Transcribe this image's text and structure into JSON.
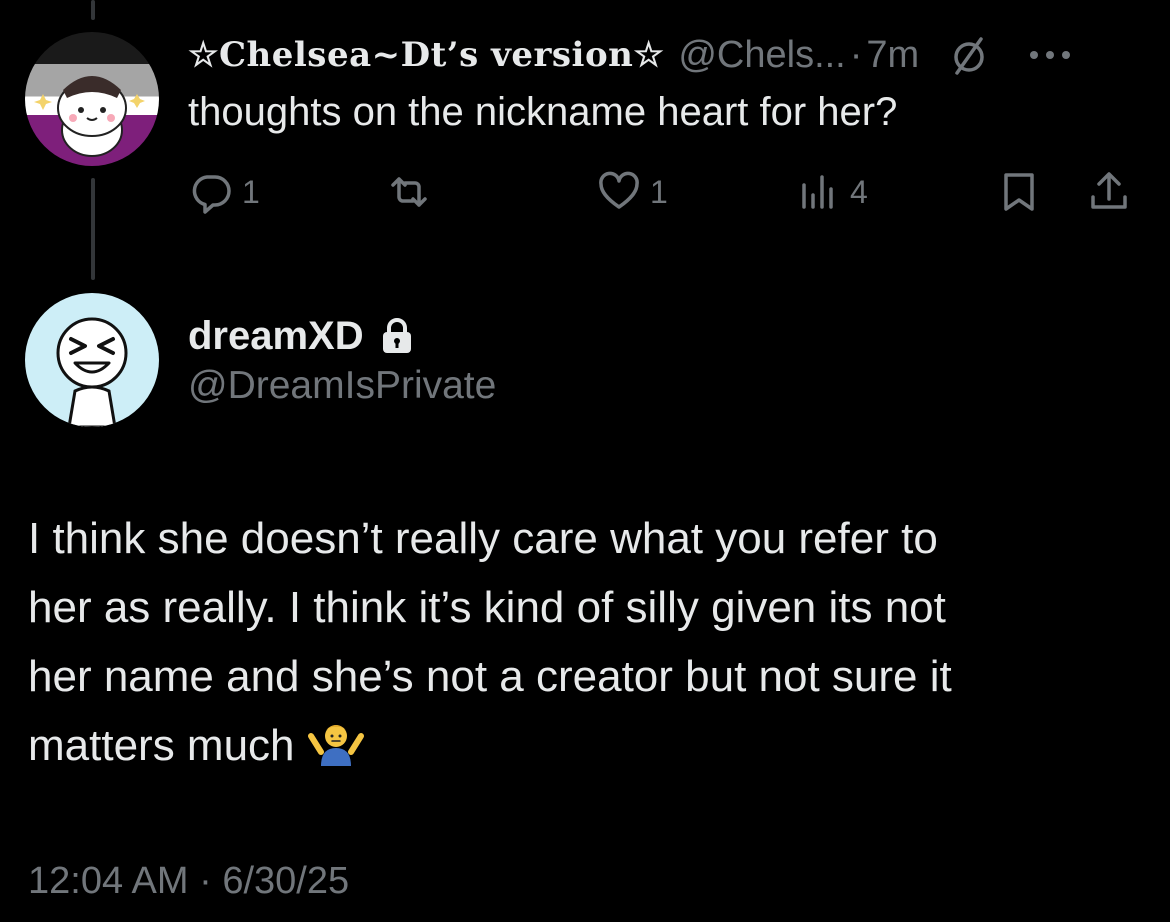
{
  "parent_tweet": {
    "display_name": "☆Chelsea~Dt’s version☆",
    "handle": "@Chels...",
    "separator": "·",
    "time": "7m",
    "text": "thoughts on the nickname heart for her?",
    "actions": {
      "reply_count": "1",
      "like_count": "1",
      "views_count": "4"
    },
    "icons": [
      "reply-icon",
      "retweet-icon",
      "like-icon",
      "views-icon",
      "bookmark-icon",
      "share-icon",
      "mute-icon",
      "more-icon"
    ]
  },
  "reply_tweet": {
    "display_name": "dreamXD",
    "handle": "@DreamIsPrivate",
    "text_lines": [
      "I think she doesn’t really care what you refer to",
      "her as really. I think it’s kind of silly given its not",
      "her name and she’s not a creator but not sure it",
      "matters much"
    ],
    "emoji": "shrug-emoji",
    "timestamp": "12:04 AM · 6/30/25"
  },
  "colors": {
    "background": "#000000",
    "primary_text": "#e7e9ea",
    "secondary_text": "#71767b",
    "thread_line": "#333639"
  }
}
